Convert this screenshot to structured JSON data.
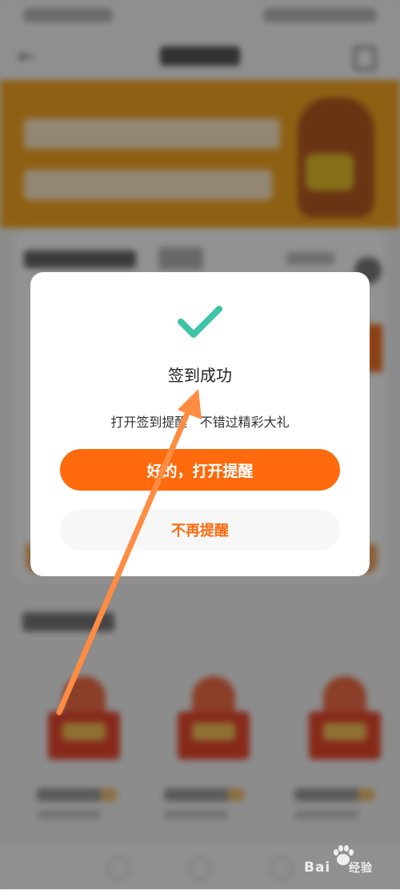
{
  "dialog": {
    "title": "签到成功",
    "message": "打开签到提醒   不错过精彩大礼",
    "primary_button": "好的，打开提醒",
    "secondary_button": "不再提醒"
  },
  "watermark": {
    "brand": "Bai",
    "suffix": "经验"
  },
  "colors": {
    "accent": "#ff6a0c",
    "check": "#3cc4a4",
    "annotation_arrow": "#ff8c42"
  },
  "icons": {
    "check": "check-icon",
    "annotation": "arrow-icon",
    "watermark": "paw-icon"
  }
}
